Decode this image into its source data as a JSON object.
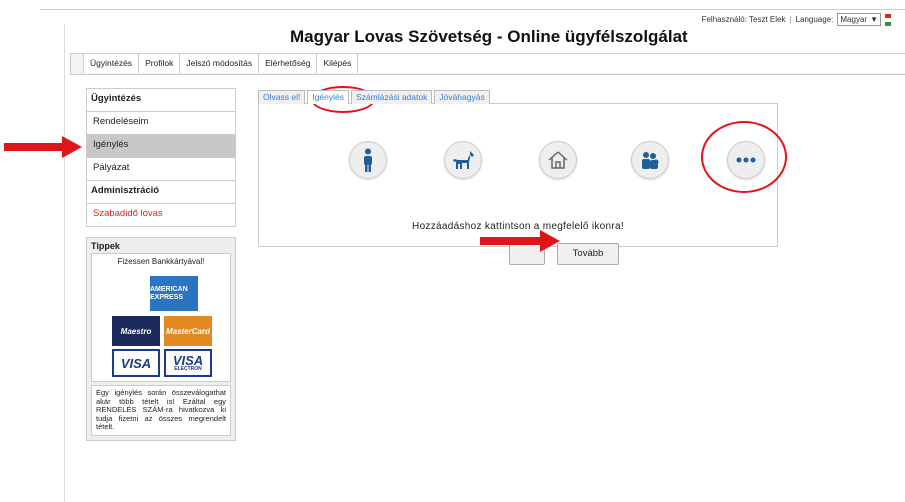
{
  "header": {
    "user_label": "Felhasználó: Teszt Elek",
    "language_label": "Language:",
    "language_value": "Magyar",
    "title": "Magyar Lovas Szövetség - Online ügyfélszolgálat"
  },
  "topnav": [
    "Ügyintézés",
    "Profilok",
    "Jelszó módosítás",
    "Elérhetőség",
    "Kilépés"
  ],
  "sidebar": {
    "section1": "Ügyintézés",
    "items1": [
      "Rendeléseim",
      "Igénylés",
      "Pályázat"
    ],
    "section2": "Adminisztráció",
    "items2": [
      "Szabadidő lovas"
    ],
    "active_item": "Igénylés"
  },
  "tips": {
    "title": "Tippek",
    "caption": "Fizessen Bankkártyával!",
    "cards": {
      "amex": "AMERICAN EXPRESS",
      "maestro": "Maestro",
      "mastercard": "MasterCard",
      "visa": "VISA",
      "visa_electron": "VISA",
      "electron": "ELECTRON"
    },
    "text": "Egy igénylés során összeválogathat akár több tételt is! Ezáltal egy RENDELÉS SZÁM-ra hivatkozva ki tudja fizetni az összes megrendelt tételt."
  },
  "content": {
    "tabs": [
      "Olvass el!",
      "Igénylés",
      "Számlázási adatok",
      "Jóváhagyás"
    ],
    "active_tab": "Igénylés",
    "icons": [
      "person-icon",
      "horse-icon",
      "house-icon",
      "group-icon",
      "more-icon"
    ],
    "instruction": "Hozzáadáshoz kattintson a megfelelő ikonra!",
    "next_button": "Tovább"
  },
  "colors": {
    "annotation_red": "#e1141c",
    "link_blue": "#3a7bd5",
    "active_gray": "#c8c8c8"
  }
}
